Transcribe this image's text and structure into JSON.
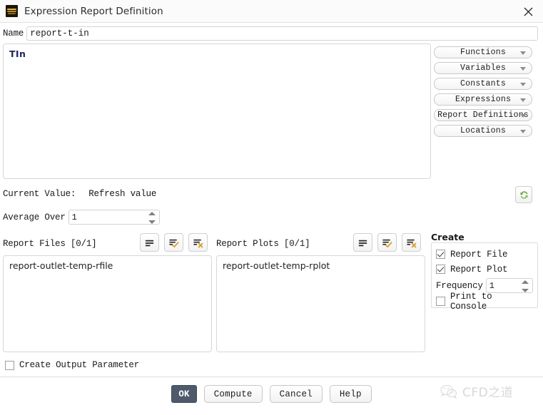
{
  "window": {
    "title": "Expression Report Definition",
    "icon": "expression-wave-icon",
    "close_label": "✕"
  },
  "name_field": {
    "label": "Name",
    "value": "report-t-in",
    "placeholder": ""
  },
  "expression": {
    "text": "TIn",
    "color": "#21265e"
  },
  "insert_buttons": [
    {
      "label": "Functions"
    },
    {
      "label": "Variables"
    },
    {
      "label": "Constants"
    },
    {
      "label": "Expressions"
    },
    {
      "label": "Report Definitions"
    },
    {
      "label": "Locations"
    }
  ],
  "current_value": {
    "label": "Current Value:",
    "action": "Refresh value",
    "refresh_icon": "refresh-icon"
  },
  "average_over": {
    "label": "Average Over",
    "value": "1"
  },
  "report_files": {
    "label": "Report Files  [0/1]",
    "items": [
      "report-outlet-temp-rfile"
    ],
    "tools": [
      {
        "icon": "list-icon",
        "name": "new-report-file"
      },
      {
        "icon": "list-check-icon",
        "name": "edit-report-file"
      },
      {
        "icon": "list-delete-icon",
        "name": "delete-report-file"
      }
    ]
  },
  "report_plots": {
    "label": "Report Plots  [0/1]",
    "items": [
      "report-outlet-temp-rplot"
    ],
    "tools": [
      {
        "icon": "list-icon",
        "name": "new-report-plot"
      },
      {
        "icon": "list-check-icon",
        "name": "edit-report-plot"
      },
      {
        "icon": "list-delete-icon",
        "name": "delete-report-plot"
      }
    ]
  },
  "create": {
    "title": "Create",
    "report_file": {
      "label": "Report File",
      "checked": true
    },
    "report_plot": {
      "label": "Report Plot",
      "checked": true
    },
    "frequency": {
      "label": "Frequency",
      "value": "1"
    },
    "print_to_console": {
      "label": "Print to Console",
      "checked": false
    }
  },
  "output_parameter": {
    "label": "Create Output Parameter",
    "checked": false
  },
  "buttons": [
    {
      "label": "OK",
      "primary": true
    },
    {
      "label": "Compute",
      "primary": false
    },
    {
      "label": "Cancel",
      "primary": false
    },
    {
      "label": "Help",
      "primary": false
    }
  ],
  "watermark": {
    "text": "CFD之道",
    "icon": "wechat-icon"
  }
}
